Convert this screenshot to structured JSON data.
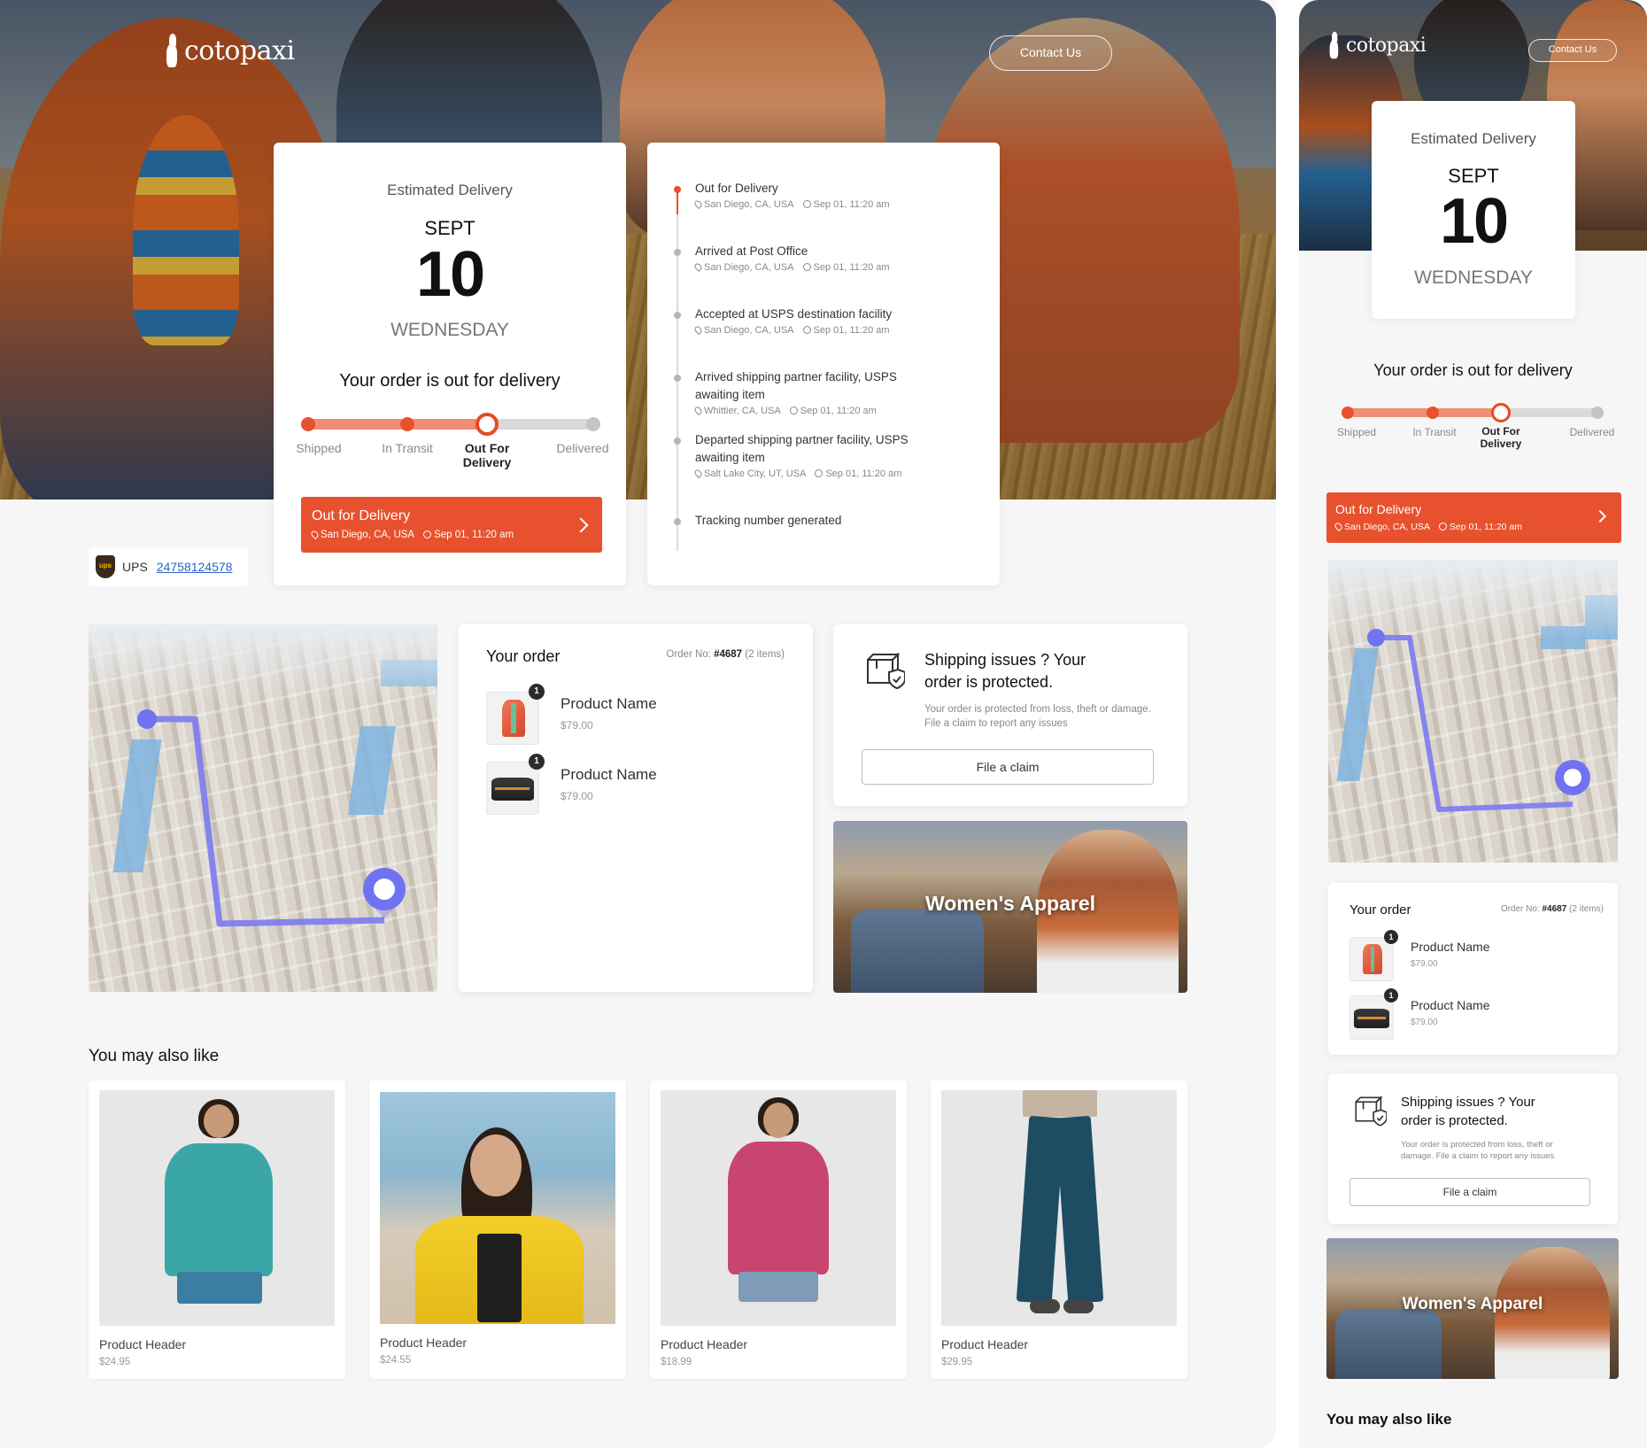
{
  "brand": {
    "name": "cotopaxi",
    "accent": "#e8512d",
    "accent_light": "#f08d73"
  },
  "header": {
    "contact_label": "Contact Us"
  },
  "delivery": {
    "estimated_label": "Estimated Delivery",
    "month": "SEPT",
    "day": "10",
    "weekday": "WEDNESDAY",
    "status_text": "Your order is out for delivery",
    "progress_steps": [
      "Shipped",
      "In Transit",
      "Out For Delivery",
      "Delivered"
    ],
    "current_step": 3,
    "banner": {
      "title": "Out for Delivery",
      "location": "San Diego, CA, USA",
      "time": "Sep 01, 11:20 am"
    }
  },
  "carrier": {
    "name": "UPS",
    "tracking_number": "24758124578"
  },
  "timeline": [
    {
      "title": "Out for Delivery",
      "location": "San Diego, CA, USA",
      "time": "Sep 01, 11:20 am",
      "active": true
    },
    {
      "title": "Arrived at Post Office",
      "location": "San Diego, CA, USA",
      "time": "Sep 01, 11:20 am",
      "active": false
    },
    {
      "title": "Accepted at USPS destination facility",
      "location": "San Diego, CA, USA",
      "time": "Sep 01, 11:20 am",
      "active": false
    },
    {
      "title": "Arrived shipping partner facility, USPS awaiting item",
      "location": "Whittier, CA, USA",
      "time": "Sep 01, 11:20 am",
      "active": false
    },
    {
      "title": "Departed shipping partner facility, USPS awaiting item",
      "location": "Salt Lake City, UT, USA",
      "time": "Sep 01, 11:20 am",
      "active": false
    },
    {
      "title": "Tracking number generated",
      "location": "",
      "time": "",
      "active": false
    }
  ],
  "order": {
    "title": "Your order",
    "order_no_label": "Order No:",
    "order_no": "#4687",
    "items_count": "(2 items)",
    "items": [
      {
        "name": "Product Name",
        "price": "$79.00",
        "qty": "1",
        "icon": "orange-backpack"
      },
      {
        "name": "Product Name",
        "price": "$79.00",
        "qty": "1",
        "icon": "black-duffel"
      }
    ]
  },
  "protection": {
    "title": "Shipping issues ? Your order is protected.",
    "body": "Your order is protected from loss, theft or damage. File a claim to report any issues",
    "button": "File a claim"
  },
  "promo": {
    "label": "Women's Apparel"
  },
  "recommendations": {
    "title": "You may also like",
    "products": [
      {
        "name": "Product Header",
        "price": "$24.95"
      },
      {
        "name": "Product Header",
        "price": "$24.55"
      },
      {
        "name": "Product Header",
        "price": "$18.99"
      },
      {
        "name": "Product Header",
        "price": "$29.95"
      }
    ]
  }
}
